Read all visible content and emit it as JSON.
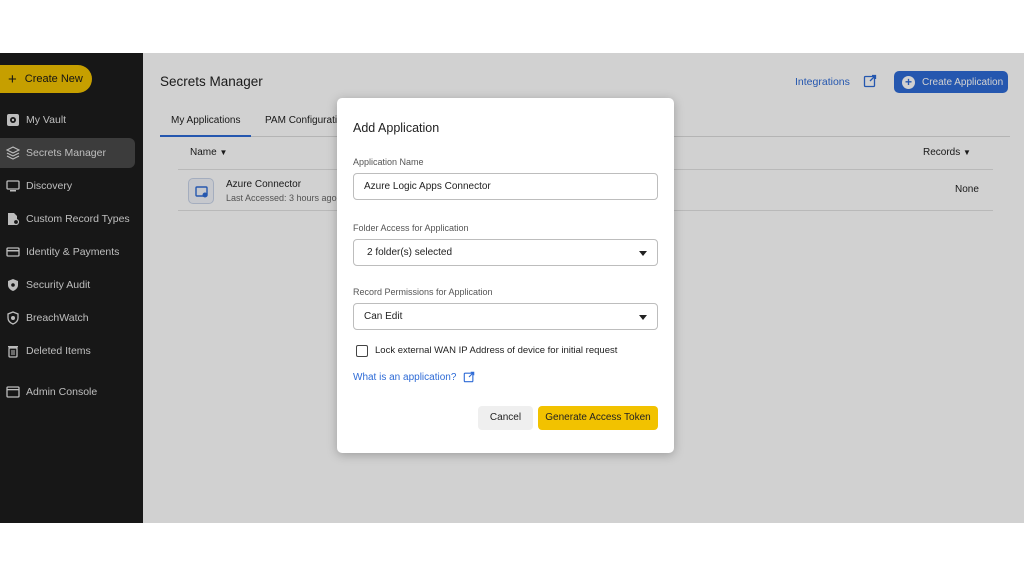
{
  "sidebar": {
    "create_label": "Create New",
    "items": [
      {
        "label": "My Vault",
        "icon": "vault-icon"
      },
      {
        "label": "Secrets Manager",
        "icon": "layers-icon"
      },
      {
        "label": "Discovery",
        "icon": "monitor-icon"
      },
      {
        "label": "Custom Record Types",
        "icon": "file-gear-icon"
      },
      {
        "label": "Identity & Payments",
        "icon": "card-icon"
      },
      {
        "label": "Security Audit",
        "icon": "shield-icon"
      },
      {
        "label": "BreachWatch",
        "icon": "breachwatch-icon"
      },
      {
        "label": "Deleted Items",
        "icon": "trash-icon"
      },
      {
        "label": "Admin Console",
        "icon": "console-icon"
      }
    ]
  },
  "header": {
    "title": "Secrets Manager",
    "integrations_label": "Integrations",
    "create_app_label": "Create Application"
  },
  "tabs": [
    {
      "label": "My Applications"
    },
    {
      "label": "PAM Configurati"
    }
  ],
  "table": {
    "col_name": "Name",
    "col_records": "Records",
    "rows": [
      {
        "name": "Azure Connector",
        "sub": "Last Accessed: 3 hours ago",
        "records": "None"
      }
    ]
  },
  "modal": {
    "title": "Add Application",
    "app_name_label": "Application Name",
    "app_name_value": "Azure Logic Apps Connector",
    "folder_label": "Folder Access for Application",
    "folder_value": "2 folder(s) selected",
    "perm_label": "Record Permissions for Application",
    "perm_value": "Can Edit",
    "lock_label": "Lock external WAN IP Address of device for initial request",
    "lock_checked": false,
    "help_link": "What is an application?",
    "cancel_label": "Cancel",
    "token_label": "Generate Access Token"
  },
  "colors": {
    "accent": "#f2c200",
    "link": "#2e6bd6",
    "sidebar_bg": "#1d1d1d"
  }
}
